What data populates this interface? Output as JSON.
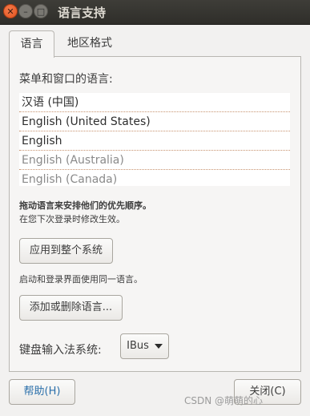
{
  "window": {
    "title": "语言支持"
  },
  "tabs": [
    {
      "label": "语言"
    },
    {
      "label": "地区格式"
    }
  ],
  "language_panel": {
    "list_heading": "菜单和窗口的语言:",
    "languages": [
      "汉语 (中国)",
      "English (United States)",
      "English",
      "English (Australia)",
      "English (Canada)"
    ],
    "drag_hint": "拖动语言来安排他们的优先顺序。",
    "login_hint": "在您下次登录时修改生效。",
    "apply_system_button": "应用到整个系统",
    "same_language_hint": "启动和登录界面使用同一语言。",
    "add_remove_button": "添加或删除语言...",
    "keyboard_input_label": "键盘输入法系统:",
    "keyboard_input_value": "IBus"
  },
  "footer": {
    "help_button": "帮助(H)",
    "close_button": "关闭(C)",
    "watermark": "CSDN @萌萌的心"
  }
}
